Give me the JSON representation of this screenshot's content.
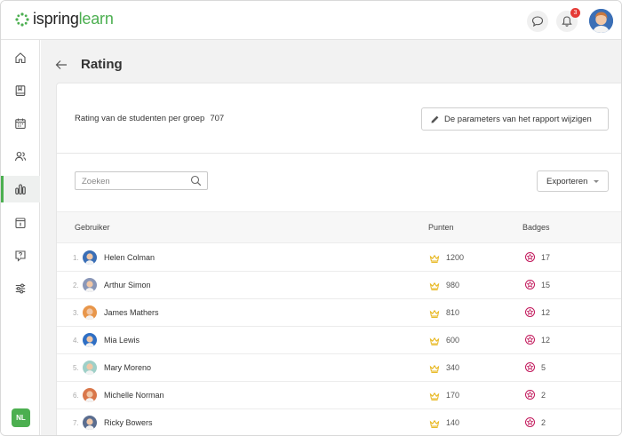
{
  "app": {
    "logo_primary": "ispring",
    "logo_secondary": "learn",
    "brand_color": "#4caf50"
  },
  "header": {
    "notification_count": "3"
  },
  "sidebar": {
    "items": [
      {
        "name": "home-icon"
      },
      {
        "name": "book-icon"
      },
      {
        "name": "calendar-icon"
      },
      {
        "name": "users-icon"
      },
      {
        "name": "bar-chart-icon",
        "active": true
      },
      {
        "name": "info-icon"
      },
      {
        "name": "help-icon"
      },
      {
        "name": "sliders-icon"
      }
    ],
    "user_initials": "NL"
  },
  "page": {
    "title": "Rating",
    "subtitle": "Rating van de studenten per groep",
    "subtitle_count": "707",
    "edit_button_label": "De parameters van het rapport wijzigen",
    "search_placeholder": "Zoeken",
    "export_label": "Exporteren"
  },
  "table": {
    "columns": {
      "user": "Gebruiker",
      "points": "Punten",
      "badges": "Badges"
    },
    "rows": [
      {
        "rank": "1.",
        "name": "Helen Colman",
        "points": "1200",
        "badges": "17",
        "avatar_color": "#3b6fb6"
      },
      {
        "rank": "2.",
        "name": "Arthur Simon",
        "points": "980",
        "badges": "15",
        "avatar_color": "#8a97b8"
      },
      {
        "rank": "3.",
        "name": "James Mathers",
        "points": "810",
        "badges": "12",
        "avatar_color": "#e8964a"
      },
      {
        "rank": "4.",
        "name": "Mia Lewis",
        "points": "600",
        "badges": "12",
        "avatar_color": "#2f6fc4"
      },
      {
        "rank": "5.",
        "name": "Mary Moreno",
        "points": "340",
        "badges": "5",
        "avatar_color": "#9fd0c8"
      },
      {
        "rank": "6.",
        "name": "Michelle Norman",
        "points": "170",
        "badges": "2",
        "avatar_color": "#d9774a"
      },
      {
        "rank": "7.",
        "name": "Ricky Bowers",
        "points": "140",
        "badges": "2",
        "avatar_color": "#5a6d8f"
      }
    ]
  }
}
